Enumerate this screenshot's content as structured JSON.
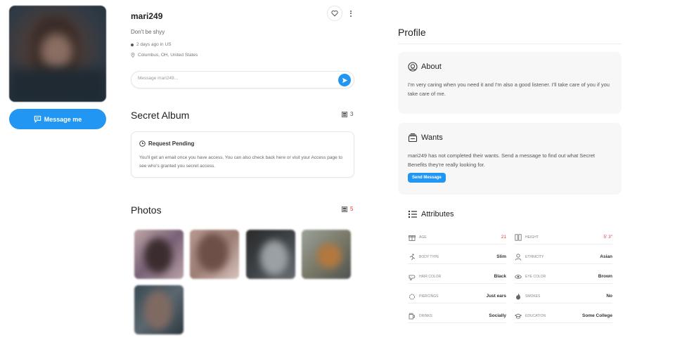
{
  "left": {
    "message_button_label": "Message me"
  },
  "header": {
    "username": "mari249",
    "tagline": "Don't be shyy",
    "last_active": "2 days ago in US",
    "location": "Columbus, OH, United States"
  },
  "composer": {
    "placeholder": "Message mari249..."
  },
  "secret_album": {
    "title": "Secret Album",
    "count": "3",
    "card_title": "Request Pending",
    "card_text": "You'll get an email once you have access. You can also check back here or visit your Access page to see who's granted you secret access."
  },
  "photos": {
    "title": "Photos",
    "count": "5",
    "items": [
      {
        "name": "photo-1"
      },
      {
        "name": "photo-2"
      },
      {
        "name": "photo-3"
      },
      {
        "name": "photo-4"
      },
      {
        "name": "photo-5"
      }
    ]
  },
  "profile": {
    "title": "Profile",
    "about_title": "About",
    "about_text": "I'm very caring when you need it and I'm also a good listener. I'll take care of you if you take care of me.",
    "wants_title": "Wants",
    "wants_text": "mari249 has not completed their wants. Send a message to find out what Secret Benefits they're really looking for.",
    "send_message_label": "Send Message",
    "attributes_title": "Attributes",
    "attributes": [
      {
        "label": "AGE",
        "value": "21",
        "icon": "gift-icon"
      },
      {
        "label": "HEIGHT",
        "value": "5' 3\"",
        "icon": "ruler-icon"
      },
      {
        "label": "BODY TYPE",
        "value": "Slim",
        "icon": "running-figure-icon"
      },
      {
        "label": "ETHNICITY",
        "value": "Asian",
        "icon": "person-icon"
      },
      {
        "label": "HAIR COLOR",
        "value": "Black",
        "icon": "hair-dryer-icon"
      },
      {
        "label": "EYE COLOR",
        "value": "Brown",
        "icon": "eye-icon"
      },
      {
        "label": "PIERCINGS",
        "value": "Just ears",
        "icon": "ring-icon"
      },
      {
        "label": "SMOKES",
        "value": "No",
        "icon": "flame-icon"
      },
      {
        "label": "DRINKS",
        "value": "Socially",
        "icon": "mug-icon"
      },
      {
        "label": "EDUCATION",
        "value": "Some College",
        "icon": "graduation-cap-icon"
      }
    ]
  },
  "colors": {
    "accent": "#2196f3",
    "highlight_red": "#e53935",
    "card_bg": "#f7f7f7"
  }
}
